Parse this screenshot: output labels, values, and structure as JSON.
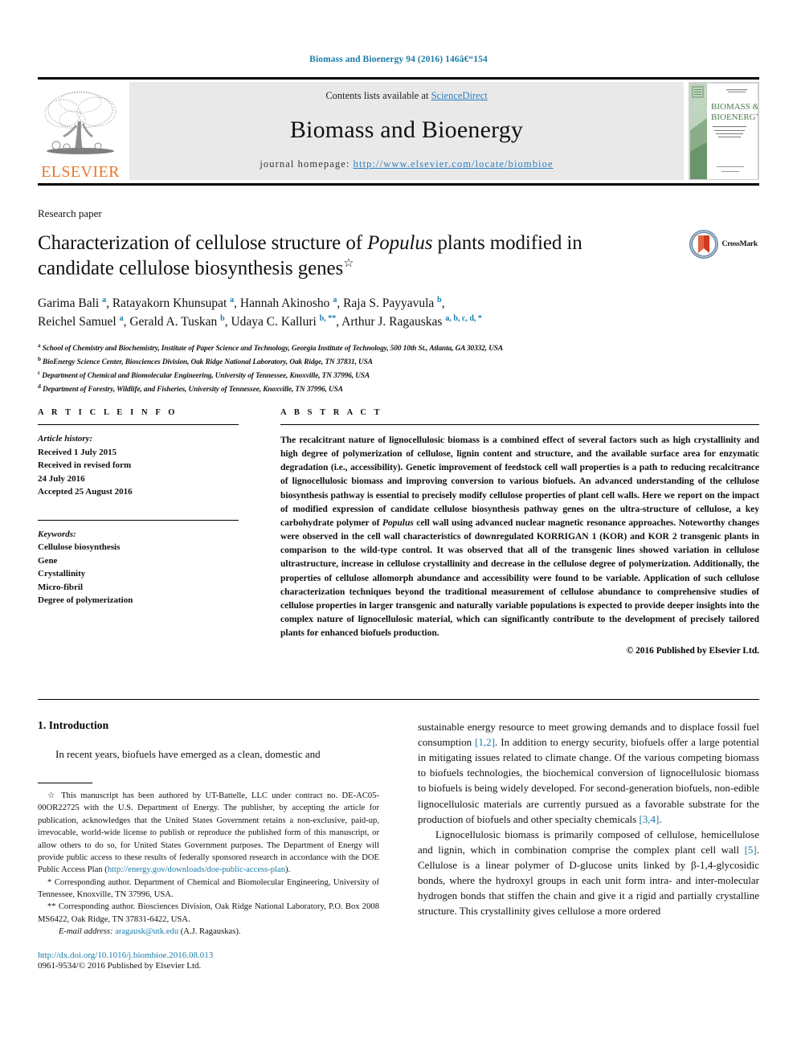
{
  "running_head": "Biomass and Bioenergy 94 (2016) 146â€“154",
  "masthead": {
    "contents_prefix": "Contents lists available at ",
    "sciencedirect": "ScienceDirect",
    "journal_title": "Biomass and Bioenergy",
    "homepage_prefix": "journal homepage: ",
    "homepage_url": "http://www.elsevier.com/locate/biombioe",
    "publisher_logo_text": "ELSEVIER",
    "cover_title_line1": "BIOMASS &",
    "cover_title_line2": "BIOENERGY",
    "link_color": "#2b7fc4"
  },
  "article": {
    "kicker": "Research paper",
    "title_part1": "Characterization of cellulose structure of ",
    "title_italic": "Populus",
    "title_part2": " plants modified in candidate cellulose biosynthesis genes",
    "title_marker": "☆",
    "crossmark_label": "CrossMark",
    "authors": [
      {
        "name": "Garima Bali",
        "sup": "a"
      },
      {
        "name": "Ratayakorn Khunsupat",
        "sup": "a"
      },
      {
        "name": "Hannah Akinosho",
        "sup": "a"
      },
      {
        "name": "Raja S. Payyavula",
        "sup": "b"
      },
      {
        "name": "Reichel Samuel",
        "sup": "a"
      },
      {
        "name": "Gerald A. Tuskan",
        "sup": "b"
      },
      {
        "name": "Udaya C. Kalluri",
        "sup": "b, **"
      },
      {
        "name": "Arthur J. Ragauskas",
        "sup": "a, b, c, d, *"
      }
    ],
    "affiliations": [
      {
        "mark": "a",
        "text": "School of Chemistry and Biochemistry, Institute of Paper Science and Technology, Georgia Institute of Technology, 500 10th St., Atlanta, GA 30332, USA"
      },
      {
        "mark": "b",
        "text": "BioEnergy Science Center, Biosciences Division, Oak Ridge National Laboratory, Oak Ridge, TN 37831, USA"
      },
      {
        "mark": "c",
        "text": "Department of Chemical and Biomolecular Engineering, University of Tennessee, Knoxville, TN 37996, USA"
      },
      {
        "mark": "d",
        "text": "Department of Forestry, Wildlife, and Fisheries, University of Tennessee, Knoxville, TN 37996, USA"
      }
    ]
  },
  "article_info": {
    "heading": "A R T I C L E   I N F O",
    "history_label": "Article history:",
    "history": [
      "Received 1 July 2015",
      "Received in revised form",
      "24 July 2016",
      "Accepted 25 August 2016"
    ],
    "keywords_label": "Keywords:",
    "keywords": [
      "Cellulose biosynthesis",
      "Gene",
      "Crystallinity",
      "Micro-fibril",
      "Degree of polymerization"
    ]
  },
  "abstract": {
    "heading": "A B S T R A C T",
    "part1": "The recalcitrant nature of lignocellulosic biomass is a combined effect of several factors such as high crystallinity and high degree of polymerization of cellulose, lignin content and structure, and the available surface area for enzymatic degradation (i.e., accessibility). Genetic improvement of feedstock cell wall properties is a path to reducing recalcitrance of lignocellulosic biomass and improving conversion to various biofuels. An advanced understanding of the cellulose biosynthesis pathway is essential to precisely modify cellulose properties of plant cell walls. Here we report on the impact of modified expression of candidate cellulose biosynthesis pathway genes on the ultra-structure of cellulose, a key carbohydrate polymer of ",
    "italic": "Populus",
    "part2": " cell wall using advanced nuclear magnetic resonance approaches. Noteworthy changes were observed in the cell wall characteristics of downregulated KORRIGAN 1 (KOR) and KOR 2 transgenic plants in comparison to the wild-type control. It was observed that all of the transgenic lines showed variation in cellulose ultrastructure, increase in cellulose crystallinity and decrease in the cellulose degree of polymerization. Additionally, the properties of cellulose allomorph abundance and accessibility were found to be variable. Application of such cellulose characterization techniques beyond the traditional measurement of cellulose abundance to comprehensive studies of cellulose properties in larger transgenic and naturally variable populations is expected to provide deeper insights into the complex nature of lignocellulosic material, which can significantly contribute to the development of precisely tailored plants for enhanced biofuels production.",
    "copyright": "© 2016 Published by Elsevier Ltd."
  },
  "body": {
    "section_heading": "1. Introduction",
    "left_para_1": "In recent years, biofuels have emerged as a clean, domestic and",
    "right_para_1_a": "sustainable energy resource to meet growing demands and to displace fossil fuel consumption ",
    "right_ref_1": "[1,2]",
    "right_para_1_b": ". In addition to energy security, biofuels offer a large potential in mitigating issues related to climate change. Of the various competing biomass to biofuels technologies, the biochemical conversion of lignocellulosic biomass to biofuels is being widely developed. For second-generation biofuels, non-edible lignocellulosic materials are currently pursued as a favorable substrate for the production of biofuels and other specialty chemicals ",
    "right_ref_2": "[3,4]",
    "right_para_1_c": ".",
    "right_para_2_a": "Lignocellulosic biomass is primarily composed of cellulose, hemicellulose and lignin, which in combination comprise the complex plant cell wall ",
    "right_ref_3": "[5]",
    "right_para_2_b": ". Cellulose is a linear polymer of D-glucose units linked by β-1,4-glycosidic bonds, where the hydroxyl groups in each unit form intra- and inter-molecular hydrogen bonds that stiffen the chain and give it a rigid and partially crystalline structure. This crystallinity gives cellulose a more ordered"
  },
  "footnotes": {
    "star_mark": "☆",
    "star_text_a": "This manuscript has been authored by UT-Battelle, LLC under contract no. DE-AC05-00OR22725 with the U.S. Department of Energy. The publisher, by accepting the article for publication, acknowledges that the United States Government retains a non-exclusive, paid-up, irrevocable, world-wide license to publish or reproduce the published form of this manuscript, or allow others to do so, for United States Government purposes. The Department of Energy will provide public access to these results of federally sponsored research in accordance with the DOE Public Access Plan (",
    "star_link": "http://energy.gov/downloads/doe-public-access-plan",
    "star_text_b": ").",
    "corr1_mark": "*",
    "corr1_text": "Corresponding author. Department of Chemical and Biomolecular Engineering, University of Tennessee, Knoxville, TN 37996, USA.",
    "corr2_mark": "**",
    "corr2_text": "Corresponding author. Biosciences Division, Oak Ridge National Laboratory, P.O. Box 2008 MS6422, Oak Ridge, TN 37831-6422, USA.",
    "email_label": "E-mail address:",
    "email_link": "aragausk@utk.edu",
    "email_suffix": " (A.J. Ragauskas)."
  },
  "footer": {
    "doi": "http://dx.doi.org/10.1016/j.biombioe.2016.08.013",
    "issn": "0961-9534/© 2016 Published by Elsevier Ltd."
  }
}
